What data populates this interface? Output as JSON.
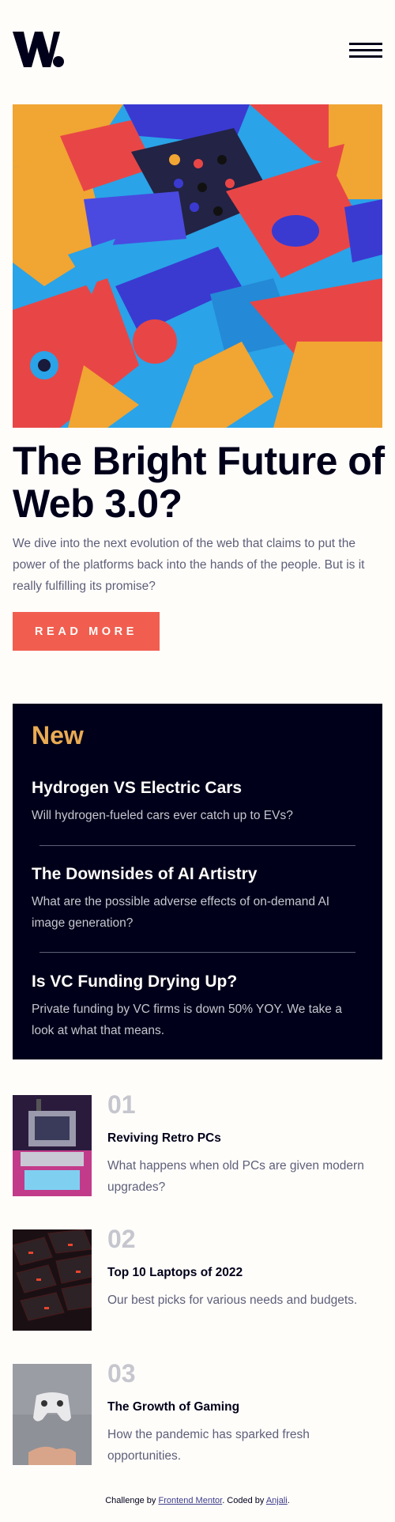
{
  "header": {
    "logo_text": "W.",
    "menu_icon": "hamburger-menu-icon"
  },
  "hero": {
    "image_icon": "abstract-3d-blocks-image",
    "title": "The Bright Future of Web 3.0?",
    "description": "We dive into the next evolution of the web that claims to put the power of the platforms back into the hands of the people. But is it really fulfilling its promise?",
    "button_label": "READ MORE"
  },
  "new_section": {
    "heading": "New",
    "items": [
      {
        "title": "Hydrogen VS Electric Cars",
        "description": "Will hydrogen-fueled cars ever catch up to EVs?"
      },
      {
        "title": "The Downsides of AI Artistry",
        "description": "What are the possible adverse effects of on-demand AI image generation?"
      },
      {
        "title": "Is VC Funding Drying Up?",
        "description": "Private funding by VC firms is down 50% YOY. We take a look at what that means."
      }
    ]
  },
  "ranked_articles": [
    {
      "number": "01",
      "title": "Reviving Retro PCs",
      "description": "What happens when old PCs are given modern upgrades?",
      "thumb_icon": "retro-pc-image"
    },
    {
      "number": "02",
      "title": "Top 10 Laptops of 2022",
      "description": "Our best picks for various needs and budgets.",
      "thumb_icon": "laptop-keyboard-image"
    },
    {
      "number": "03",
      "title": "The Growth of Gaming",
      "description": "How the pandemic has sparked fresh opportunities.",
      "thumb_icon": "game-controller-image"
    }
  ],
  "footer": {
    "prefix": "Challenge by ",
    "link1": "Frontend Mentor",
    "middle": ". Coded by ",
    "link2": "Anjali",
    "suffix": "."
  },
  "colors": {
    "accent_red": "#f15e50",
    "accent_orange": "#e9ab53",
    "dark_navy": "#00001a",
    "background": "#fffdfa",
    "grayish_blue": "#5d5f79",
    "grayish_light": "#c5c6ce"
  }
}
